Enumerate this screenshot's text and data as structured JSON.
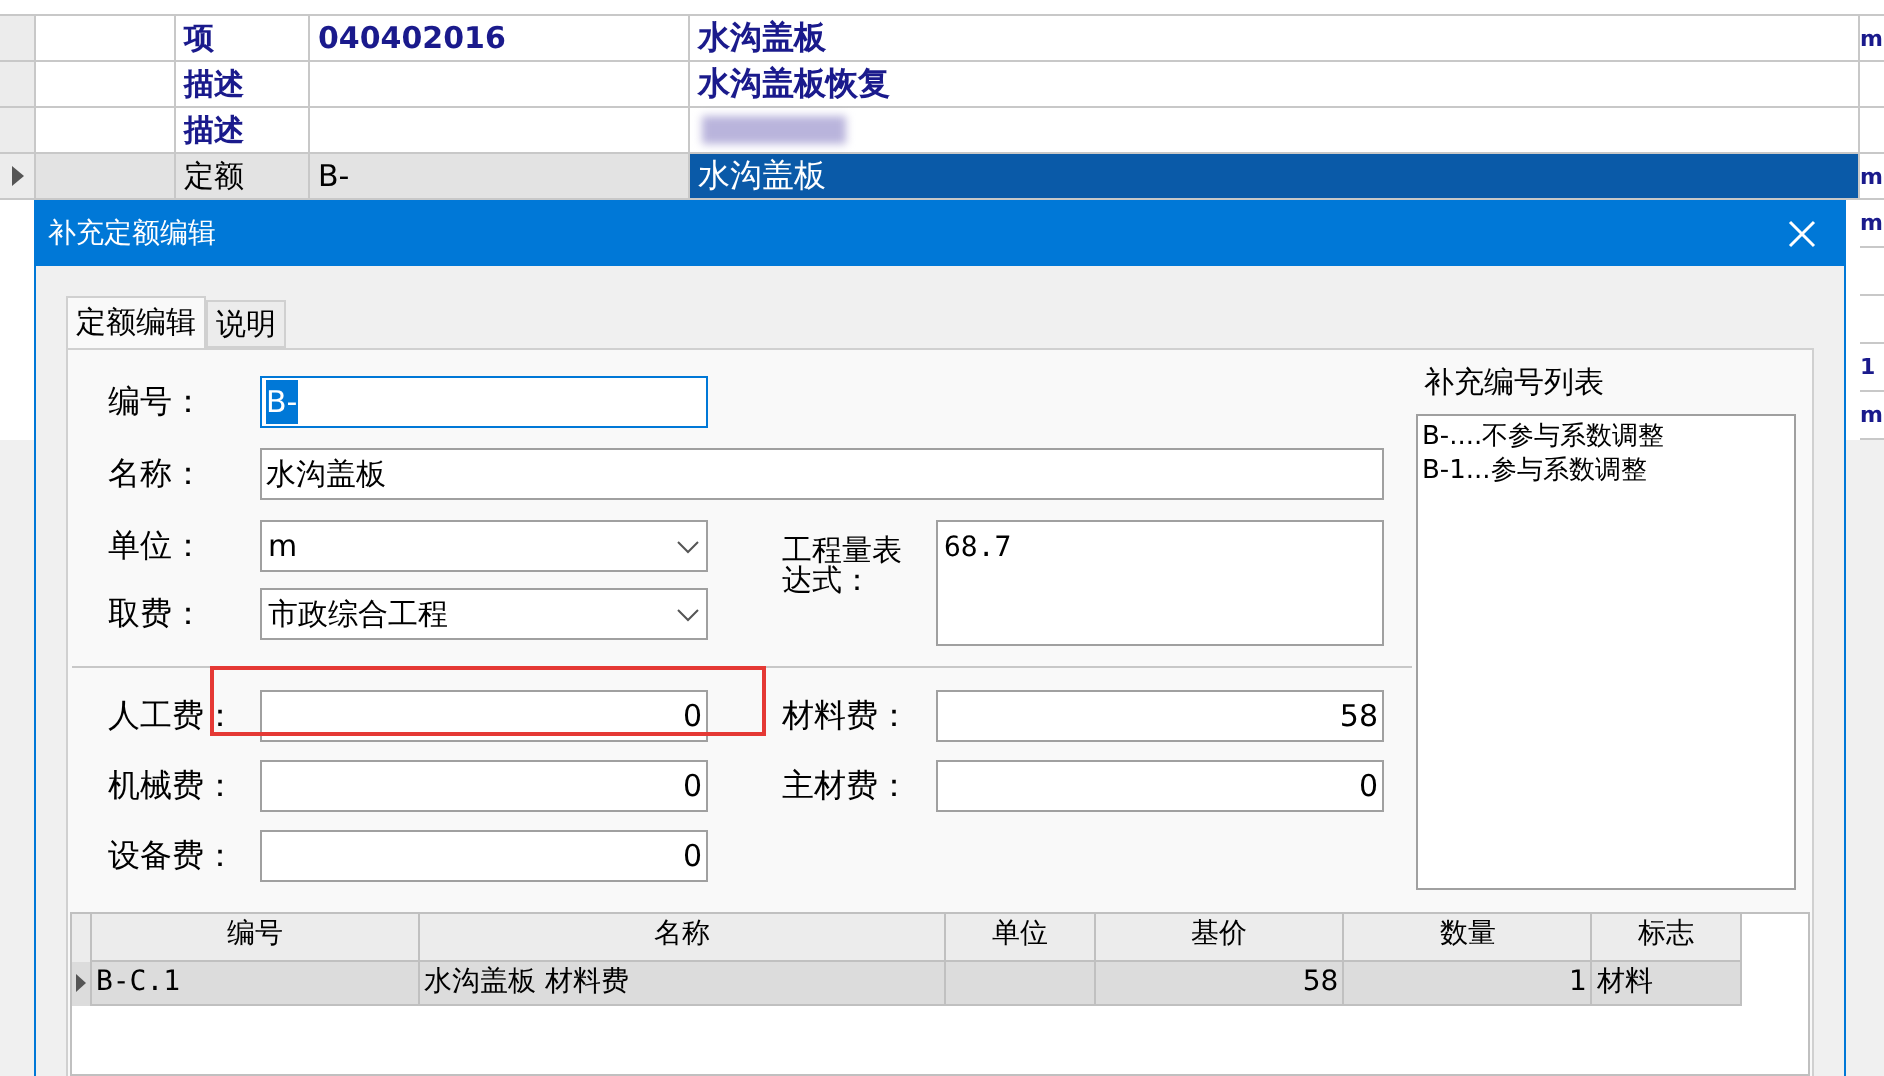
{
  "background_grid": {
    "rows": [
      {
        "selected": false,
        "type": "项",
        "code": "040402016",
        "name": "水沟盖板",
        "edge": "m",
        "bold": true
      },
      {
        "selected": false,
        "type": "描述",
        "code": "",
        "name": "水沟盖板恢复",
        "edge": "",
        "bold": true
      },
      {
        "selected": false,
        "type": "描述",
        "code": "",
        "name": "",
        "blurred": true,
        "edge": "",
        "bold": true
      },
      {
        "selected": true,
        "type": "定额",
        "code": "B-",
        "name": "水沟盖板",
        "edge": "m",
        "bold": false
      }
    ],
    "edge_cells": [
      "m",
      "",
      "",
      "1",
      "m"
    ]
  },
  "dialog": {
    "title": "补充定额编辑",
    "tabs": [
      {
        "label": "定额编辑",
        "selected": true
      },
      {
        "label": "说明",
        "selected": false
      }
    ],
    "fields": {
      "code": {
        "label": "编号：",
        "value": "B-"
      },
      "name": {
        "label": "名称：",
        "value": "水沟盖板"
      },
      "unit": {
        "label": "单位：",
        "value": "m"
      },
      "fee": {
        "label": "取费：",
        "value": "市政综合工程"
      },
      "expression": {
        "label": "工程量表达式：",
        "value": "68.7"
      }
    },
    "costs_left": [
      {
        "label": "人工费：",
        "value": "0"
      },
      {
        "label": "机械费：",
        "value": "0"
      },
      {
        "label": "设备费：",
        "value": "0"
      }
    ],
    "costs_right": [
      {
        "label": "材料费：",
        "value": "58"
      },
      {
        "label": "主材费：",
        "value": "0"
      }
    ],
    "code_list": {
      "title": "补充编号列表",
      "items": [
        "B-....不参与系数调整",
        "B-1...参与系数调整"
      ]
    },
    "table": {
      "columns": [
        "编号",
        "名称",
        "单位",
        "基价",
        "数量",
        "标志"
      ],
      "rows": [
        {
          "selected": true,
          "cells": [
            "B-C.1",
            "水沟盖板 材料费",
            "",
            "58",
            "1",
            "材料"
          ]
        }
      ]
    }
  }
}
